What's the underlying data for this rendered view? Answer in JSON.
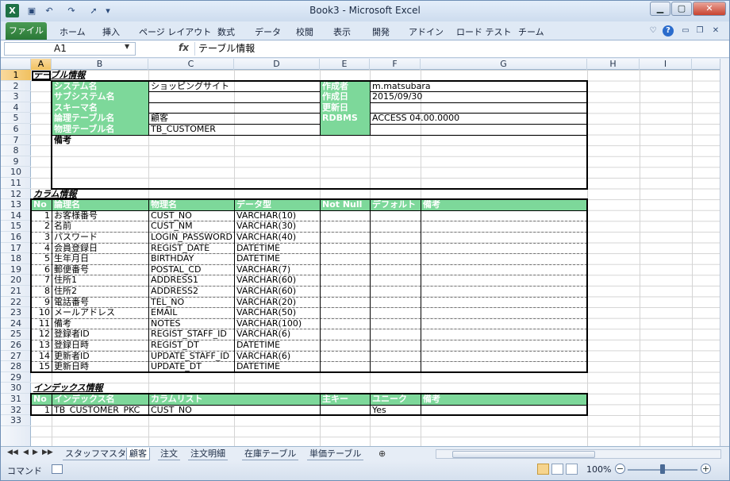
{
  "window": {
    "title": "Book3 - Microsoft Excel",
    "min": "▁",
    "max": "▢",
    "close": "✕"
  },
  "quick_access": {
    "save_icon": "save-icon",
    "undo_icon": "undo-icon",
    "redo_icon": "redo-icon"
  },
  "ribbon": {
    "file_tab": "ファイル",
    "tabs": [
      "ホーム",
      "挿入",
      "ページ レイアウト",
      "数式",
      "データ",
      "校閲",
      "表示",
      "開発",
      "アドイン",
      "ロード テスト",
      "チーム"
    ]
  },
  "formula_bar": {
    "name_box": "A1",
    "fx": "fx",
    "content": "テーブル情報"
  },
  "columns": [
    "A",
    "B",
    "C",
    "D",
    "E",
    "F",
    "G",
    "H",
    "I"
  ],
  "rows": [
    "1",
    "2",
    "3",
    "4",
    "5",
    "6",
    "7",
    "8",
    "9",
    "10",
    "11",
    "12",
    "13",
    "14",
    "15",
    "16",
    "17",
    "18",
    "19",
    "20",
    "21",
    "22",
    "23",
    "24",
    "25",
    "26",
    "27",
    "28",
    "29",
    "30",
    "31",
    "32",
    "33"
  ],
  "table_info": {
    "heading": "テーブル情報",
    "system_name_label": "システム名",
    "system_name": "ショッピングサイト",
    "subsystem_label": "サブシステム名",
    "subsystem": "",
    "schema_label": "スキーマ名",
    "schema": "",
    "logical_name_label": "論理テーブル名",
    "logical_name": "顧客",
    "physical_name_label": "物理テーブル名",
    "physical_name": "TB_CUSTOMER",
    "author_label": "作成者",
    "author": "m.matsubara",
    "created_label": "作成日",
    "created": "2015/09/30",
    "updated_label": "更新日",
    "updated": "",
    "rdbms_label": "RDBMS",
    "rdbms": "ACCESS 04.00.0000",
    "remarks_label": "備考"
  },
  "column_info": {
    "heading": "カラム情報",
    "headers": [
      "No",
      "論理名",
      "物理名",
      "データ型",
      "Not Null",
      "デフォルト",
      "備考"
    ],
    "rows": [
      [
        "1",
        "お客様番号",
        "CUST_NO",
        "VARCHAR(10)"
      ],
      [
        "2",
        "名前",
        "CUST_NM",
        "VARCHAR(30)"
      ],
      [
        "3",
        "パスワード",
        "LOGIN_PASSWORD",
        "VARCHAR(40)"
      ],
      [
        "4",
        "会員登録日",
        "REGIST_DATE",
        "DATETIME"
      ],
      [
        "5",
        "生年月日",
        "BIRTHDAY",
        "DATETIME"
      ],
      [
        "6",
        "郵便番号",
        "POSTAL_CD",
        "VARCHAR(7)"
      ],
      [
        "7",
        "住所1",
        "ADDRESS1",
        "VARCHAR(60)"
      ],
      [
        "8",
        "住所2",
        "ADDRESS2",
        "VARCHAR(60)"
      ],
      [
        "9",
        "電話番号",
        "TEL_NO",
        "VARCHAR(20)"
      ],
      [
        "10",
        "メールアドレス",
        "EMAIL",
        "VARCHAR(50)"
      ],
      [
        "11",
        "備考",
        "NOTES",
        "VARCHAR(100)"
      ],
      [
        "12",
        "登録者ID",
        "REGIST_STAFF_ID",
        "VARCHAR(6)"
      ],
      [
        "13",
        "登録日時",
        "REGIST_DT",
        "DATETIME"
      ],
      [
        "14",
        "更新者ID",
        "UPDATE_STAFF_ID",
        "VARCHAR(6)"
      ],
      [
        "15",
        "更新日時",
        "UPDATE_DT",
        "DATETIME"
      ]
    ]
  },
  "index_info": {
    "heading": "インデックス情報",
    "headers": [
      "No",
      "インデックス名",
      "カラムリスト",
      "主キー",
      "ユニーク",
      "備考"
    ],
    "rows": [
      [
        "1",
        "TB_CUSTOMER_PKC",
        "CUST_NO",
        "",
        "Yes",
        ""
      ]
    ]
  },
  "sheet_tabs": [
    "スタッフマスタ",
    "顧客",
    "注文",
    "注文明細",
    "在庫テーブル",
    "単価テーブル"
  ],
  "active_sheet": "顧客",
  "status": {
    "mode": "コマンド",
    "zoom": "100%"
  }
}
